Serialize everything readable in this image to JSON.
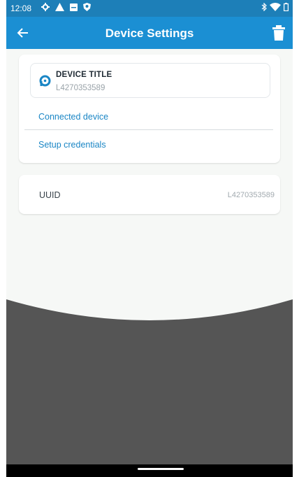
{
  "status_bar": {
    "time": "12:08",
    "left_icons": [
      "settings-icon",
      "warning-icon",
      "image-icon",
      "location-icon"
    ],
    "right_icons": [
      "bluetooth-icon",
      "wifi-icon",
      "battery-icon"
    ]
  },
  "app_bar": {
    "title": "Device Settings",
    "back_icon": "arrow-back-icon",
    "delete_icon": "trash-icon"
  },
  "device_card": {
    "title": "DEVICE TITLE",
    "device_id": "L4270353589",
    "links": {
      "connected": "Connected device",
      "setup": "Setup credentials"
    }
  },
  "uuid_card": {
    "label": "UUID",
    "value": "L4270353589"
  },
  "colors": {
    "status_bar": "#1d7fb8",
    "app_bar": "#1b8fd3",
    "link": "#1a86c5",
    "dark_area": "#555555"
  }
}
